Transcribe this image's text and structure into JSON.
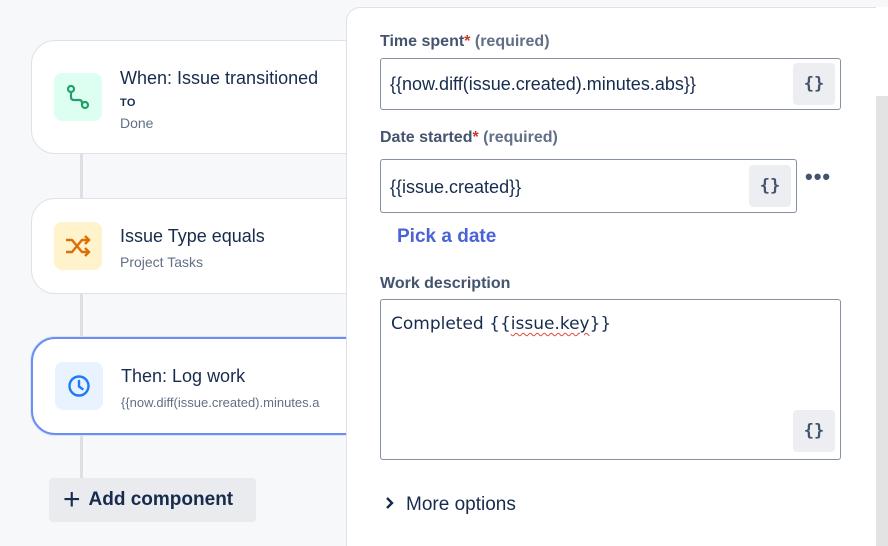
{
  "rule_canvas": {
    "trigger": {
      "title": "When: Issue transitioned",
      "to_label": "TO",
      "status": "Done",
      "icon": "transition-icon"
    },
    "condition": {
      "title": "Issue Type equals",
      "value": "Project Tasks",
      "icon": "shuffle-icon"
    },
    "action": {
      "title": "Then: Log work",
      "value": "{{now.diff(issue.created).minutes.a",
      "icon": "clock-icon"
    },
    "add_component_label": "Add component"
  },
  "panel": {
    "time_spent": {
      "label": "Time spent",
      "required_mark": "*",
      "required_text": "(required)",
      "value": "{{now.diff(issue.created).minutes.abs}}"
    },
    "date_started": {
      "label": "Date started",
      "required_mark": "*",
      "required_text": "(required)",
      "value": "{{issue.created}}",
      "pick_date_link": "Pick a date"
    },
    "work_description": {
      "label": "Work description",
      "value_prefix": "Completed {{",
      "value_misspelled": "issue.key",
      "value_suffix": "}}"
    },
    "smart_value_button": "{}",
    "more_dots": "•••",
    "more_options_label": "More options"
  },
  "colors": {
    "trigger_icon_bg": "#dcfff1",
    "trigger_icon_fg": "#22a06b",
    "condition_icon_bg": "#fff3cc",
    "condition_icon_fg": "#d97008",
    "action_icon_bg": "#e9f2ff",
    "action_icon_fg": "#1d7afc",
    "link": "#4a63d6",
    "required": "#c9372c"
  }
}
